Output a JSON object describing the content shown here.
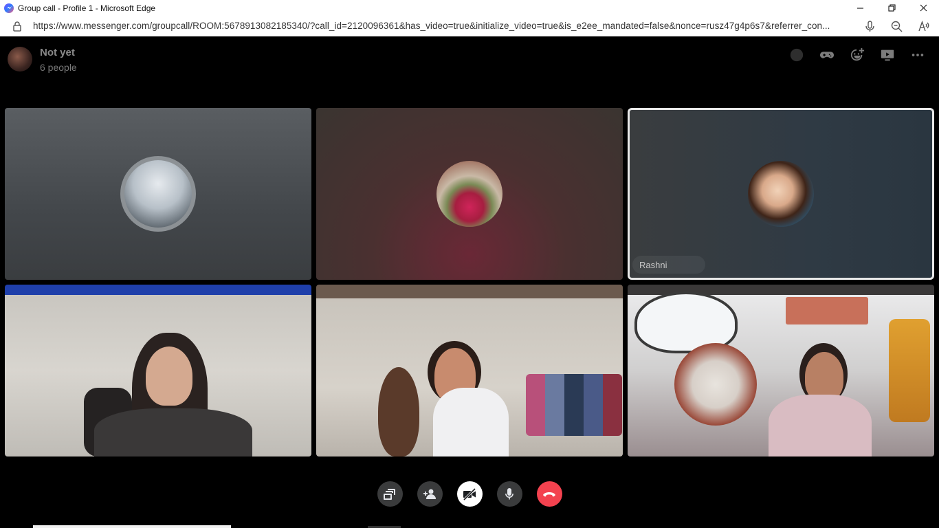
{
  "window": {
    "title": "Group call - Profile 1 - Microsoft Edge",
    "controls": [
      "minimize",
      "restore",
      "close"
    ]
  },
  "address_bar": {
    "url": "https://www.messenger.com/groupcall/ROOM:5678913082185340/?call_id=2120096361&has_video=true&initialize_video=true&is_e2ee_mandated=false&nonce=rusz47g4p6s7&referrer_con..."
  },
  "call": {
    "group_name": "Not yet",
    "participant_count": "6 people",
    "header_actions": [
      "add-effect-icon",
      "games-icon",
      "emoji-effect-icon",
      "share-screen-icon",
      "more-options-icon"
    ]
  },
  "tiles": [
    {
      "type": "avatar",
      "name": ""
    },
    {
      "type": "avatar",
      "name": ""
    },
    {
      "type": "avatar",
      "name": "Rashni",
      "active_speaker": true
    },
    {
      "type": "video",
      "name": ""
    },
    {
      "type": "video",
      "name": ""
    },
    {
      "type": "video",
      "name": ""
    }
  ],
  "control_bar": {
    "buttons": [
      "switch-layout",
      "add-people",
      "video-off",
      "microphone",
      "end-call"
    ]
  },
  "colors": {
    "end_call": "#f3424f",
    "control_bg": "#3a3b3c",
    "active_border": "#e8e8e8"
  }
}
